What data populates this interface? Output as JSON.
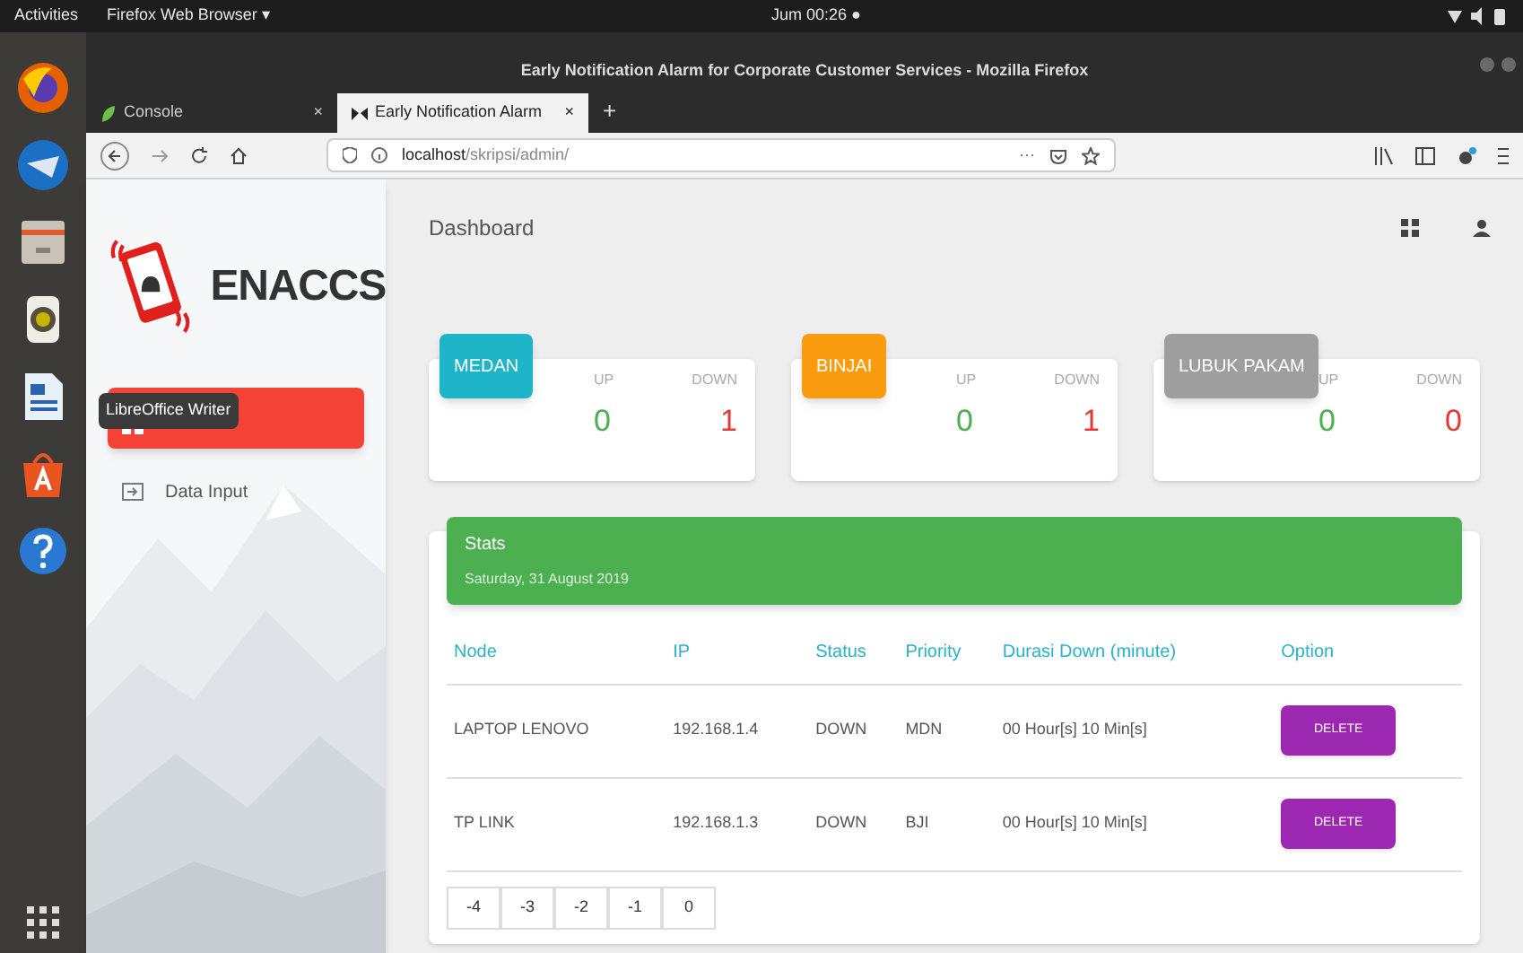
{
  "top_bar": {
    "activities": "Activities",
    "app_menu": "Firefox Web Browser ▾",
    "clock": "Jum 00:26 ●"
  },
  "window": {
    "title": "Early Notification Alarm for Corporate Customer Services - Mozilla Firefox"
  },
  "tabs": [
    {
      "label": "Console",
      "close": "×",
      "selected": false
    },
    {
      "label": "Early Notification Alarm",
      "close": "×",
      "selected": true
    }
  ],
  "new_tab": "+",
  "address_bar": {
    "host": "localhost",
    "path": "/skripsi/admin/",
    "more": "···"
  },
  "dock_tooltip": "LibreOffice Writer",
  "sidebar": {
    "logo": "ENACCS",
    "items": [
      {
        "selected": true
      },
      {
        "label": "Data Input",
        "selected": false
      }
    ]
  },
  "page_title": "Dashboard",
  "locations": [
    {
      "name": "MEDAN",
      "color": "#1fb5c9",
      "up_label": "UP",
      "down_label": "DOWN",
      "up": "0",
      "down": "1"
    },
    {
      "name": "BINJAI",
      "color": "#fb9b0f",
      "up_label": "UP",
      "down_label": "DOWN",
      "up": "0",
      "down": "1"
    },
    {
      "name": "LUBUK PAKAM",
      "color": "#9e9e9e",
      "up_label": "UP",
      "down_label": "DOWN",
      "up": "0",
      "down": "0"
    }
  ],
  "stats": {
    "title": "Stats",
    "date": "Saturday, 31 August 2019",
    "columns": [
      "Node",
      "IP",
      "Status",
      "Priority",
      "Durasi Down (minute)",
      "Option"
    ],
    "rows": [
      {
        "node": "LAPTOP LENOVO",
        "ip": "192.168.1.4",
        "status": "DOWN",
        "priority": "MDN",
        "duration": "00 Hour[s] 10 Min[s]",
        "action": "DELETE"
      },
      {
        "node": "TP LINK",
        "ip": "192.168.1.3",
        "status": "DOWN",
        "priority": "BJI",
        "duration": "00 Hour[s] 10 Min[s]",
        "action": "DELETE"
      }
    ],
    "pages": [
      "-4",
      "-3",
      "-2",
      "-1",
      "0"
    ]
  }
}
